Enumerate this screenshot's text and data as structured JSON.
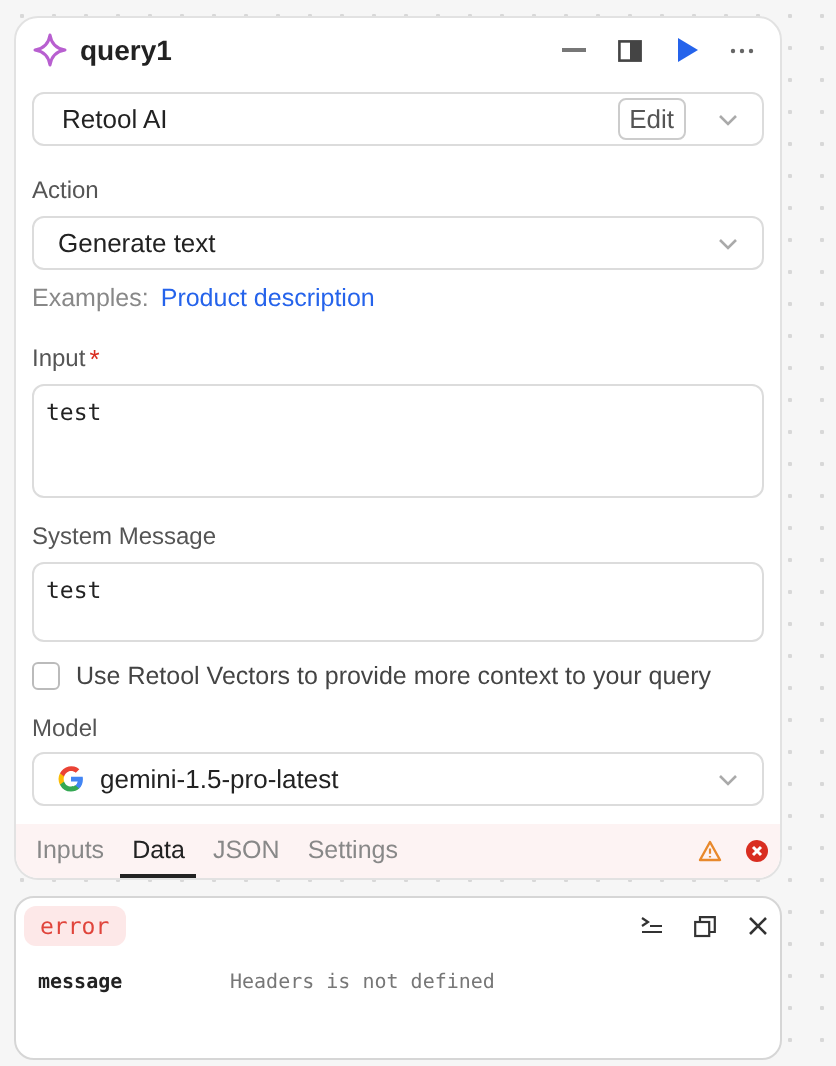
{
  "query": {
    "title": "query1"
  },
  "resource": {
    "value": "Retool AI",
    "edit_label": "Edit"
  },
  "action": {
    "label": "Action",
    "value": "Generate text"
  },
  "examples": {
    "label": "Examples:",
    "link": "Product description"
  },
  "input": {
    "label": "Input",
    "required_mark": "*",
    "value": "test"
  },
  "system_message": {
    "label": "System Message",
    "value": "test"
  },
  "vectors": {
    "label": "Use Retool Vectors to provide more context to your query",
    "checked": false
  },
  "model": {
    "label": "Model",
    "value": "gemini-1.5-pro-latest"
  },
  "tabs": [
    {
      "label": "Inputs",
      "selected": false
    },
    {
      "label": "Data",
      "selected": true
    },
    {
      "label": "JSON",
      "selected": false
    },
    {
      "label": "Settings",
      "selected": false
    }
  ],
  "error": {
    "badge": "error",
    "rows": [
      {
        "key": "message",
        "value": "Headers is not defined"
      }
    ]
  }
}
